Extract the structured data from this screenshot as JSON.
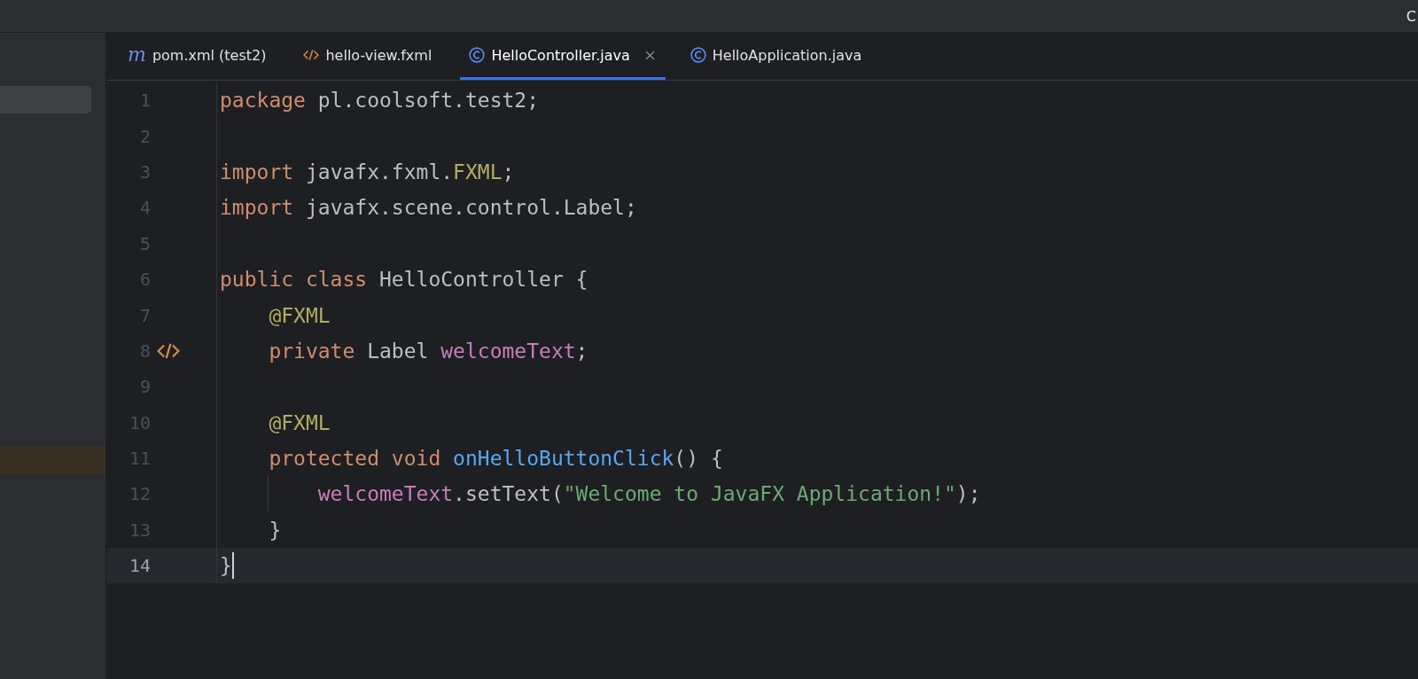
{
  "title_bar": {
    "text": "C"
  },
  "tabs": [
    {
      "label": "pom.xml (test2)",
      "kind": "maven",
      "icon_glyph": "m",
      "selected": false
    },
    {
      "label": "hello-view.fxml",
      "kind": "xml",
      "selected": false
    },
    {
      "label": "HelloController.java",
      "kind": "class",
      "selected": true
    },
    {
      "label": "HelloApplication.java",
      "kind": "class",
      "selected": false
    }
  ],
  "editor": {
    "lines": [
      {
        "number": "1",
        "current": false,
        "gutter_icon": false,
        "tokens": [
          {
            "kind": "keyword",
            "text": "package "
          },
          {
            "kind": "plain",
            "text": "pl.coolsoft.test2;"
          }
        ]
      },
      {
        "number": "2",
        "current": false,
        "gutter_icon": false
      },
      {
        "number": "3",
        "current": false,
        "gutter_icon": false,
        "tokens": [
          {
            "kind": "keyword",
            "text": "import "
          },
          {
            "kind": "plain",
            "text": "javafx.fxml."
          },
          {
            "kind": "annotation",
            "text": "FXML"
          },
          {
            "kind": "plain",
            "text": ";"
          }
        ]
      },
      {
        "number": "4",
        "current": false,
        "gutter_icon": false,
        "tokens": [
          {
            "kind": "keyword",
            "text": "import "
          },
          {
            "kind": "plain",
            "text": "javafx.scene.control.Label;"
          }
        ]
      },
      {
        "number": "5",
        "current": false,
        "gutter_icon": false
      },
      {
        "number": "6",
        "current": false,
        "gutter_icon": false,
        "tokens": [
          {
            "kind": "keyword",
            "text": "public class "
          },
          {
            "kind": "plain",
            "text": "HelloController "
          },
          {
            "kind": "brace",
            "text": "{"
          }
        ]
      },
      {
        "number": "7",
        "current": false,
        "gutter_icon": false,
        "tokens": [
          {
            "kind": "annotation",
            "text": "    @FXML"
          }
        ]
      },
      {
        "number": "8",
        "current": false,
        "gutter_icon": true,
        "tokens": [
          {
            "kind": "keyword",
            "text": "    private "
          },
          {
            "kind": "plain",
            "text": "Label "
          },
          {
            "kind": "field",
            "text": "welcomeText"
          },
          {
            "kind": "plain",
            "text": ";"
          }
        ]
      },
      {
        "number": "9",
        "current": false,
        "gutter_icon": false
      },
      {
        "number": "10",
        "current": false,
        "gutter_icon": false,
        "tokens": [
          {
            "kind": "annotation",
            "text": "    @FXML"
          }
        ]
      },
      {
        "number": "11",
        "current": false,
        "gutter_icon": false,
        "tokens": [
          {
            "kind": "keyword",
            "text": "    protected void "
          },
          {
            "kind": "method",
            "text": "onHelloButtonClick"
          },
          {
            "kind": "plain",
            "text": "() {"
          }
        ]
      },
      {
        "number": "12",
        "current": false,
        "gutter_icon": false,
        "indent_guide": true,
        "tokens": [
          {
            "kind": "field",
            "text": "        welcomeText"
          },
          {
            "kind": "plain",
            "text": ".setText("
          },
          {
            "kind": "string",
            "text": "\"Welcome to JavaFX Application!\""
          },
          {
            "kind": "plain",
            "text": ");"
          }
        ]
      },
      {
        "number": "13",
        "current": false,
        "gutter_icon": false,
        "tokens": [
          {
            "kind": "plain",
            "text": "    }"
          }
        ]
      },
      {
        "number": "14",
        "current": true,
        "gutter_icon": false,
        "tokens": [
          {
            "kind": "brace",
            "text": "}"
          }
        ]
      }
    ]
  }
}
